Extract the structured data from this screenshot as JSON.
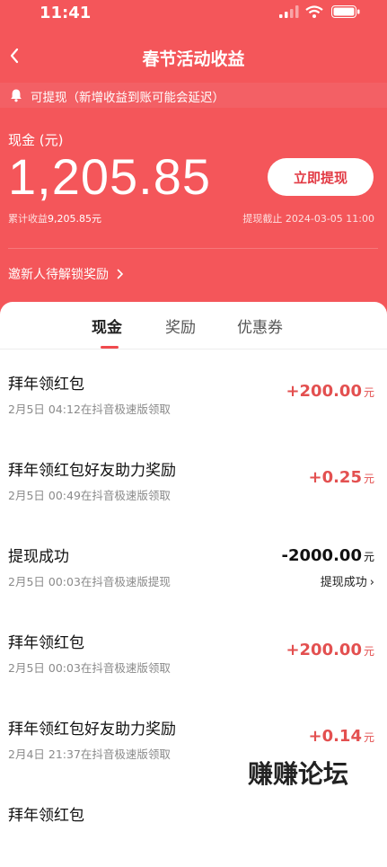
{
  "status_bar": {
    "time": "11:41"
  },
  "nav": {
    "title": "春节活动收益"
  },
  "notice": {
    "text": "可提现（新增收益到账可能会延迟）"
  },
  "balance": {
    "label": "现金 (元)",
    "amount": "1,205.85",
    "withdraw_button": "立即提现",
    "total_label": "累计收益",
    "total_value": "9,205.85元",
    "deadline": "提现截止 2024-03-05 11:00"
  },
  "invite": {
    "text": "邀新人待解锁奖励"
  },
  "tabs": [
    {
      "label": "现金"
    },
    {
      "label": "奖励"
    },
    {
      "label": "优惠券"
    }
  ],
  "rows": [
    {
      "title": "拜年领红包",
      "subtitle": "2月5日 04:12在抖音极速版领取",
      "amount": "+200.00",
      "unit": "元"
    },
    {
      "title": "拜年领红包好友助力奖励",
      "subtitle": "2月5日 00:49在抖音极速版领取",
      "amount": "+0.25",
      "unit": "元"
    },
    {
      "title": "提现成功",
      "subtitle": "2月5日 00:03在抖音极速版提现",
      "amount": "-2000.00",
      "unit": "元",
      "status": "提现成功"
    },
    {
      "title": "拜年领红包",
      "subtitle": "2月5日 00:03在抖音极速版领取",
      "amount": "+200.00",
      "unit": "元"
    },
    {
      "title": "拜年领红包好友助力奖励",
      "subtitle": "2月4日 21:37在抖音极速版领取",
      "amount": "+0.14",
      "unit": "元"
    },
    {
      "title": "拜年领红包",
      "subtitle": "",
      "amount": "",
      "unit": ""
    }
  ],
  "watermark": "赚赚论坛",
  "colors": {
    "header_bg": "#f4565a",
    "accent": "#e35050"
  }
}
